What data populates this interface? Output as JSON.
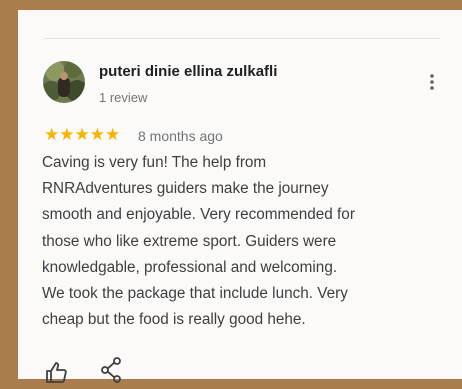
{
  "review": {
    "author_name": "puteri dinie ellina zulkafli",
    "author_meta": "1 review",
    "rating": 5,
    "stars": "★★★★★",
    "date": "8 months ago",
    "text_lines": [
      "Caving is very fun! The help from",
      "RNRAdventures guiders make the journey",
      "smooth and enjoyable. Very recommended for",
      "those who like extreme sport. Guiders were",
      "knowledgable, professional and welcoming.",
      "We took the package that include lunch. Very",
      "cheap but the food is really good hehe."
    ]
  },
  "actions": {
    "more_icon": "more-vert-icon",
    "like_icon": "thumb-up-icon",
    "share_icon": "share-icon"
  },
  "colors": {
    "star": "#f6b400",
    "frame": "#a97d4e",
    "card": "#fbfaf8"
  }
}
